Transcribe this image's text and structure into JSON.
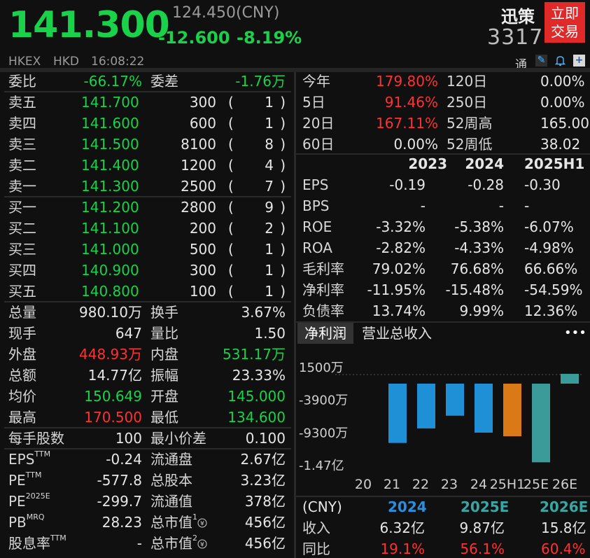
{
  "header": {
    "price": "141.300",
    "ref_price": "124.450(CNY)",
    "change": "-12.600",
    "change_pct": "-8.19%",
    "name": "迅策",
    "code": "3317",
    "trade_btn_line1": "立即",
    "trade_btn_line2": "交易",
    "exchange": "HKEX",
    "currency": "HKD",
    "time": "16:08:22",
    "tong": "通",
    "icons": [
      "edit-icon",
      "bell-icon",
      "add-icon"
    ]
  },
  "left": {
    "ratio": {
      "label": "委比",
      "value": "-66.17%",
      "diff_label": "委差",
      "diff_value": "-1.76万"
    },
    "asks": [
      {
        "label": "卖五",
        "price": "141.700",
        "vol": "300",
        "count": "1"
      },
      {
        "label": "卖四",
        "price": "141.600",
        "vol": "600",
        "count": "1"
      },
      {
        "label": "卖三",
        "price": "141.500",
        "vol": "8100",
        "count": "8"
      },
      {
        "label": "卖二",
        "price": "141.400",
        "vol": "1200",
        "count": "4"
      },
      {
        "label": "卖一",
        "price": "141.300",
        "vol": "2500",
        "count": "7"
      }
    ],
    "bids": [
      {
        "label": "买一",
        "price": "141.200",
        "vol": "2800",
        "count": "9"
      },
      {
        "label": "买二",
        "price": "141.100",
        "vol": "200",
        "count": "2"
      },
      {
        "label": "买三",
        "price": "141.000",
        "vol": "500",
        "count": "1"
      },
      {
        "label": "买四",
        "price": "140.900",
        "vol": "300",
        "count": "1"
      },
      {
        "label": "买五",
        "price": "140.800",
        "vol": "100",
        "count": "1"
      }
    ],
    "stats": [
      {
        "l1": "总量",
        "v1": "980.10万",
        "c1": "w",
        "l2": "换手",
        "v2": "3.67%",
        "c2": "w"
      },
      {
        "l1": "现手",
        "v1": "647",
        "c1": "w",
        "l2": "量比",
        "v2": "1.50",
        "c2": "w"
      },
      {
        "l1": "外盘",
        "v1": "448.93万",
        "c1": "r",
        "l2": "内盘",
        "v2": "531.17万",
        "c2": "g"
      },
      {
        "l1": "总额",
        "v1": "14.77亿",
        "c1": "w",
        "l2": "振幅",
        "v2": "23.33%",
        "c2": "w"
      },
      {
        "l1": "均价",
        "v1": "150.649",
        "c1": "g",
        "l2": "开盘",
        "v2": "145.000",
        "c2": "g"
      },
      {
        "l1": "最高",
        "v1": "170.500",
        "c1": "r",
        "l2": "最低",
        "v2": "134.600",
        "c2": "g"
      }
    ],
    "lot": {
      "l1": "每手股数",
      "v1": "100",
      "l2": "最小价差",
      "v2": "0.100"
    },
    "valuation": [
      {
        "l1": "EPS",
        "s1": "TTM",
        "v1": "-0.24",
        "l2": "流通盘",
        "s2": "",
        "v2": "2.67亿"
      },
      {
        "l1": "PE",
        "s1": "TTM",
        "v1": "-577.8",
        "l2": "总股本",
        "s2": "",
        "v2": "3.23亿"
      },
      {
        "l1": "PE",
        "s1": "2025E",
        "v1": "-299.7",
        "l2": "流通值",
        "s2": "",
        "v2": "378亿"
      },
      {
        "l1": "PB",
        "s1": "MRQ",
        "v1": "28.23",
        "l2": "总市值",
        "s2": "1",
        "v2": "456亿"
      },
      {
        "l1": "股息率",
        "s1": "TTM",
        "v1": "-",
        "l2": "总市值",
        "s2": "2",
        "v2": "456亿"
      }
    ]
  },
  "right": {
    "perf": [
      {
        "l1": "今年",
        "v1": "179.80%",
        "c1": "r",
        "l2": "120日",
        "v2": "0.00%"
      },
      {
        "l1": "5日",
        "v1": "91.46%",
        "c1": "r",
        "l2": "250日",
        "v2": "0.00%"
      },
      {
        "l1": "20日",
        "v1": "167.11%",
        "c1": "r",
        "l2": "52周高",
        "v2": "165.00"
      },
      {
        "l1": "60日",
        "v1": "0.00%",
        "c1": "w",
        "l2": "52周低",
        "v2": "38.02"
      }
    ],
    "fin_years": [
      "2023",
      "2024",
      "2025H1"
    ],
    "fin_rows": [
      {
        "label": "EPS",
        "vals": [
          "-0.19",
          "-0.28",
          "-0.30"
        ]
      },
      {
        "label": "BPS",
        "vals": [
          "-",
          "-",
          "-"
        ]
      },
      {
        "label": "ROE",
        "vals": [
          "-3.32%",
          "-5.38%",
          "-6.07%"
        ]
      },
      {
        "label": "ROA",
        "vals": [
          "-2.82%",
          "-4.33%",
          "-4.98%"
        ]
      },
      {
        "label": "毛利率",
        "vals": [
          "79.02%",
          "76.68%",
          "66.66%"
        ]
      },
      {
        "label": "净利率",
        "vals": [
          "-11.95%",
          "-15.48%",
          "-54.59%"
        ]
      },
      {
        "label": "负债率",
        "vals": [
          "13.74%",
          "9.99%",
          "12.36%"
        ]
      }
    ],
    "tabs": {
      "active": "净利润",
      "other": "营业总收入",
      "more": "•••"
    },
    "forecast": {
      "unit_label": "(CNY)",
      "years": [
        "2024",
        "2025E",
        "2026E"
      ],
      "rows": [
        {
          "label": "收入",
          "vals": [
            "6.32亿",
            "9.87亿",
            "15.8亿"
          ],
          "color": "w"
        },
        {
          "label": "同比",
          "vals": [
            "19.1%",
            "56.1%",
            "60.4%"
          ],
          "color": "r"
        }
      ]
    }
  },
  "chart_data": {
    "type": "bar",
    "categories": [
      "20",
      "21",
      "22",
      "23",
      "24",
      "25H1",
      "25E",
      "26E"
    ],
    "values": [
      null,
      -9800,
      -7400,
      -5300,
      -8100,
      -8700,
      -13000,
      1500
    ],
    "ytick_labels": [
      "1500万",
      "-3900万",
      "-9300万",
      "-1.47亿"
    ],
    "ytick_values": [
      1500,
      -3900,
      -9300,
      -14700
    ],
    "ylim": [
      -14700,
      1500
    ],
    "xtick_labels": [
      "20",
      "21",
      "22",
      "23",
      "24",
      "25H1",
      "25E",
      "26E"
    ],
    "colors": {
      "actual": "#1f8fd6",
      "half": "#d97a16",
      "forecast": "#3a9b98"
    }
  }
}
